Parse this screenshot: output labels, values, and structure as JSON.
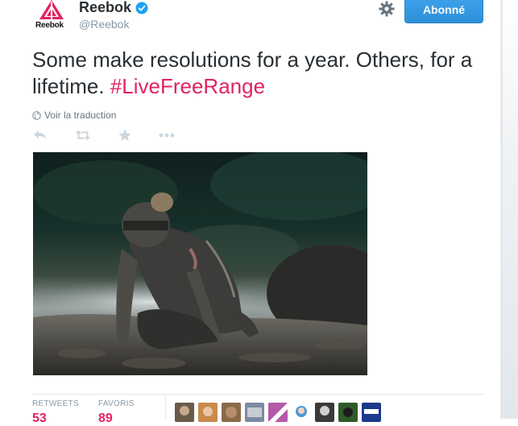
{
  "profile": {
    "name": "Reebok",
    "handle": "@Reebok",
    "logo_text": "Reebok"
  },
  "follow_button": {
    "label": "Abonné"
  },
  "tweet": {
    "text": "Some make resolutions for a year. Others, for a lifetime. ",
    "hashtag": "#LiveFreeRange"
  },
  "translate": {
    "label": "Voir la traduction"
  },
  "actions": [
    "reply-icon",
    "retweet-icon",
    "favorite-icon",
    "more-icon"
  ],
  "stats": {
    "retweets_label": "RETWEETS",
    "retweets_value": "53",
    "favorites_label": "FAVORIS",
    "favorites_value": "89"
  },
  "colors": {
    "brand_red": "#e0245e",
    "follow_blue": "#2e8fd8",
    "muted_gray": "#8899a6"
  },
  "photo": {
    "subject": "mud-covered athlete kneeling in mud"
  },
  "avatars_count": 9
}
